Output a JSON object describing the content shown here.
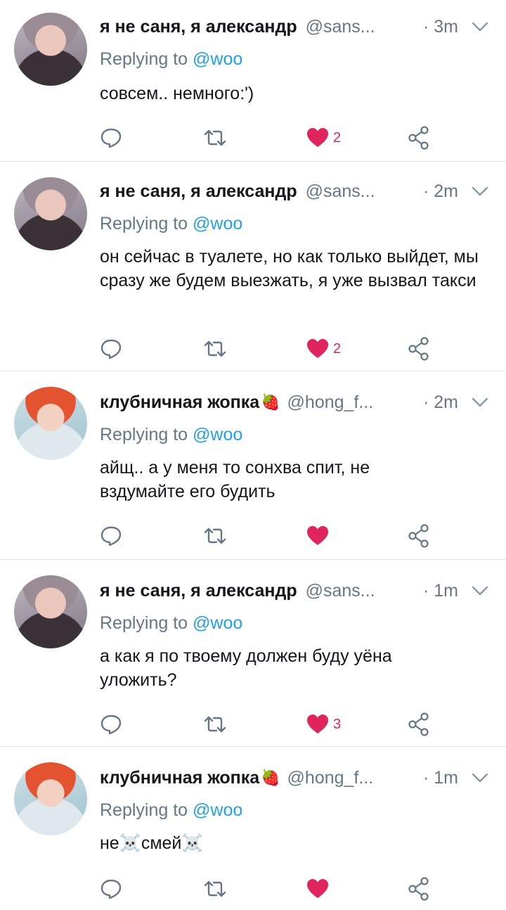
{
  "colors": {
    "like": "#e0245e",
    "link": "#1da1f2",
    "muted": "#657786"
  },
  "tweets": [
    {
      "name": "я не саня, я александр",
      "emoji": "",
      "handle": "@sans...",
      "time": "· 3m",
      "replying_label": "Replying to",
      "replying_to": "@woo",
      "text": "совсем.. немного:')",
      "likes": "2",
      "liked": true
    },
    {
      "name": "я не саня, я александр",
      "emoji": "",
      "handle": "@sans...",
      "time": "· 2m",
      "replying_label": "Replying to",
      "replying_to": "@woo",
      "text": "он сейчас в туалете, но как только выйдет, мы сразу же будем выезжать, я уже вызвал такси",
      "likes": "2",
      "liked": true
    },
    {
      "name": "клубничная жопка",
      "emoji": "🍓",
      "handle": "@hong_f...",
      "time": "· 2m",
      "replying_label": "Replying to",
      "replying_to": "@woo",
      "text": "айщ.. а у меня то сонхва спит, не вздумайте его будить",
      "likes": "",
      "liked": true
    },
    {
      "name": "я не саня, я александр",
      "emoji": "",
      "handle": "@sans...",
      "time": "· 1m",
      "replying_label": "Replying to",
      "replying_to": "@woo",
      "text": "а как я по твоему должен буду уёна уложить?",
      "likes": "3",
      "liked": true
    },
    {
      "name": "клубничная жопка",
      "emoji": "🍓",
      "handle": "@hong_f...",
      "time": "· 1m",
      "replying_label": "Replying to",
      "replying_to": "@woo",
      "text": "не☠️смей☠️",
      "likes": "",
      "liked": true
    }
  ]
}
